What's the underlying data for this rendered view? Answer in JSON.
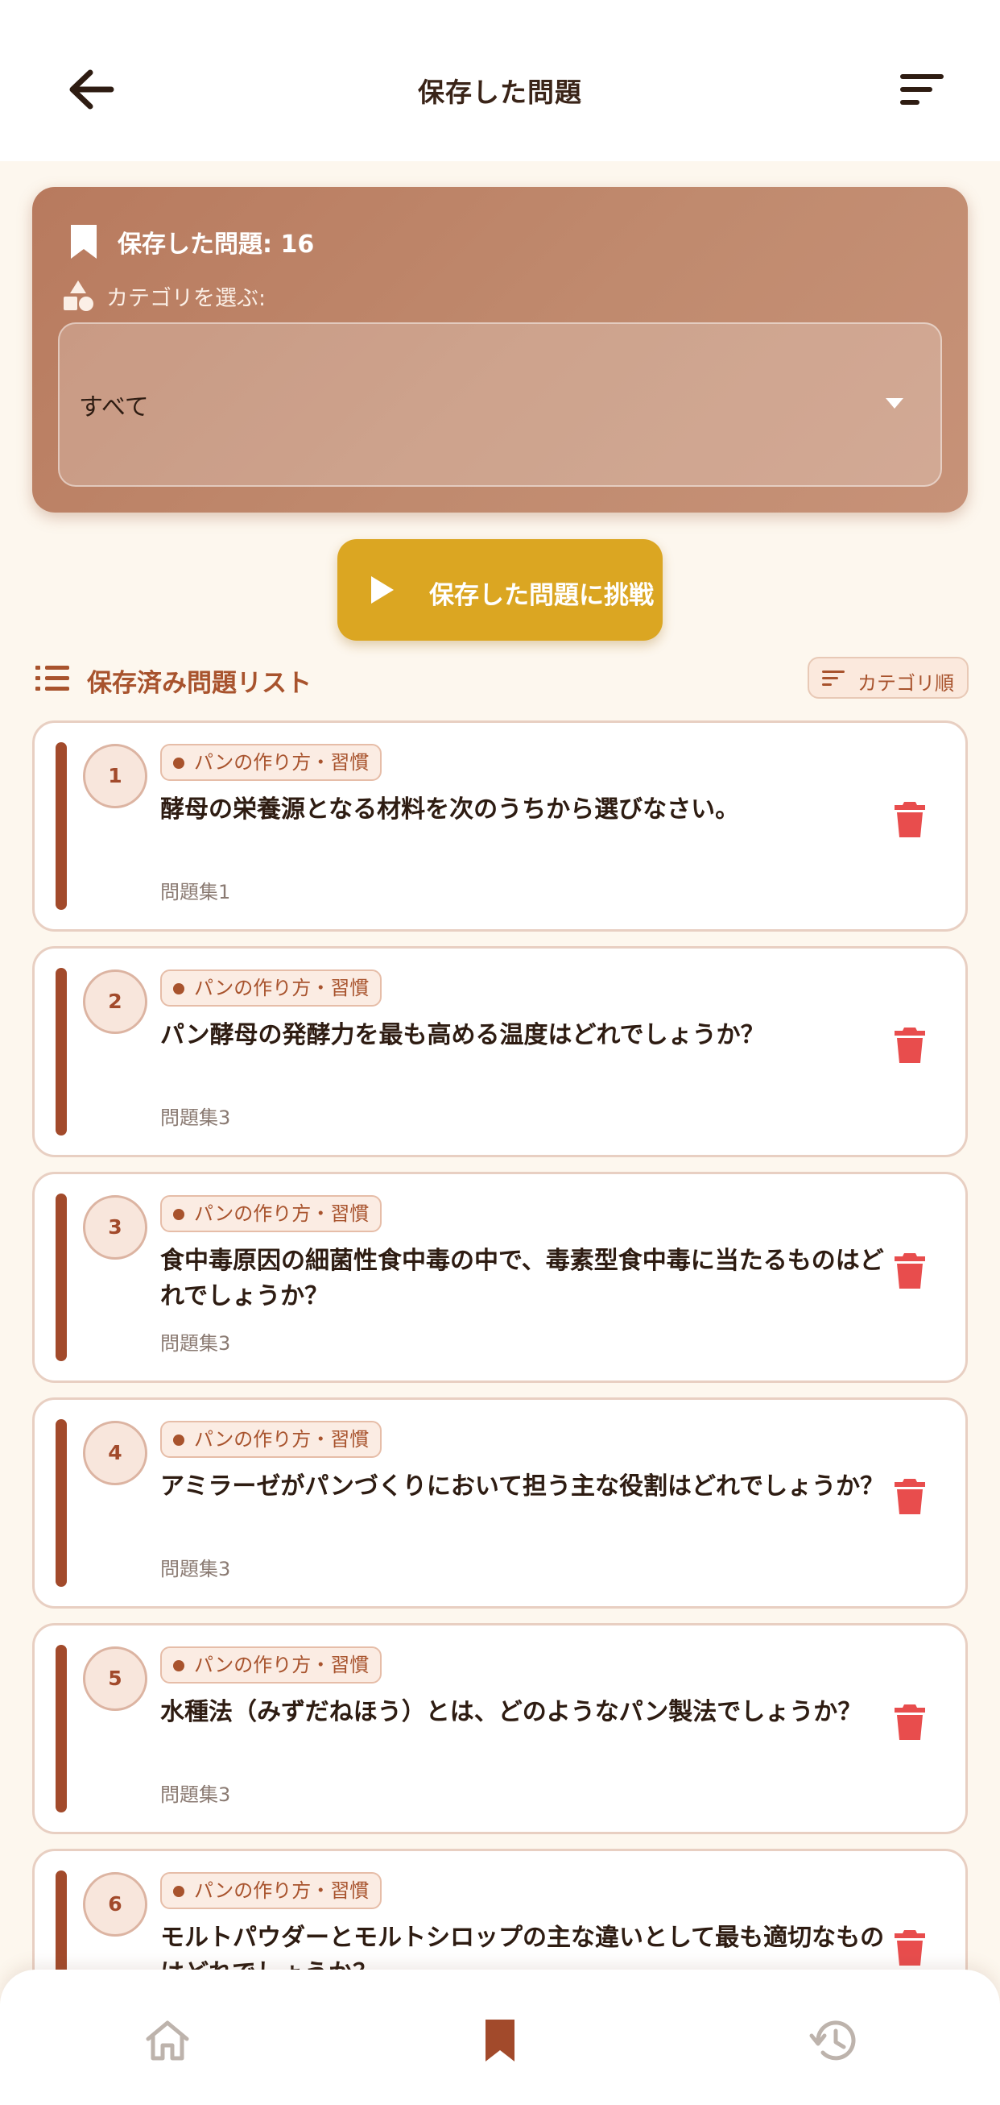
{
  "header": {
    "title": "保存した問題"
  },
  "summary": {
    "saved_count_text": "保存した問題: 16",
    "category_label": "カテゴリを選ぶ:",
    "category_selected": "すべて"
  },
  "challenge_button": {
    "label": "保存した問題に挑戦"
  },
  "list": {
    "title": "保存済み問題リスト",
    "sort_label": "カテゴリ順"
  },
  "questions": [
    {
      "number": "1",
      "category": "パンの作り方・習慣",
      "text": "酵母の栄養源となる材料を次のうちから選びなさい。",
      "set": "問題集1"
    },
    {
      "number": "2",
      "category": "パンの作り方・習慣",
      "text": "パン酵母の発酵力を最も高める温度はどれでしょうか？",
      "set": "問題集3"
    },
    {
      "number": "3",
      "category": "パンの作り方・習慣",
      "text": "食中毒原因の細菌性食中毒の中で、毒素型食中毒に当たるものはどれでしょうか？",
      "set": "問題集3"
    },
    {
      "number": "4",
      "category": "パンの作り方・習慣",
      "text": "アミラーゼがパンづくりにおいて担う主な役割はどれでしょうか？",
      "set": "問題集3"
    },
    {
      "number": "5",
      "category": "パンの作り方・習慣",
      "text": "水種法（みずだねほう）とは、どのようなパン製法でしょうか？",
      "set": "問題集3"
    },
    {
      "number": "6",
      "category": "パンの作り方・習慣",
      "text": "モルトパウダーとモルトシロップの主な違いとして最も適切なものはどれでしょうか？",
      "set": ""
    }
  ],
  "colors": {
    "accent_brown": "#a24a2b",
    "challenge_yellow": "#dba622",
    "delete_red": "#e84d4d",
    "background": "#fdf7ee"
  },
  "icons": {
    "back": "arrow-left-icon",
    "sort": "sort-lines-icon",
    "bookmark": "bookmark-icon",
    "category": "shapes-icon",
    "dropdown": "caret-down-icon",
    "play": "play-icon",
    "list": "list-icon",
    "delete": "trash-icon",
    "nav_home": "home-icon",
    "nav_saved": "bookmark-icon",
    "nav_history": "history-icon"
  }
}
